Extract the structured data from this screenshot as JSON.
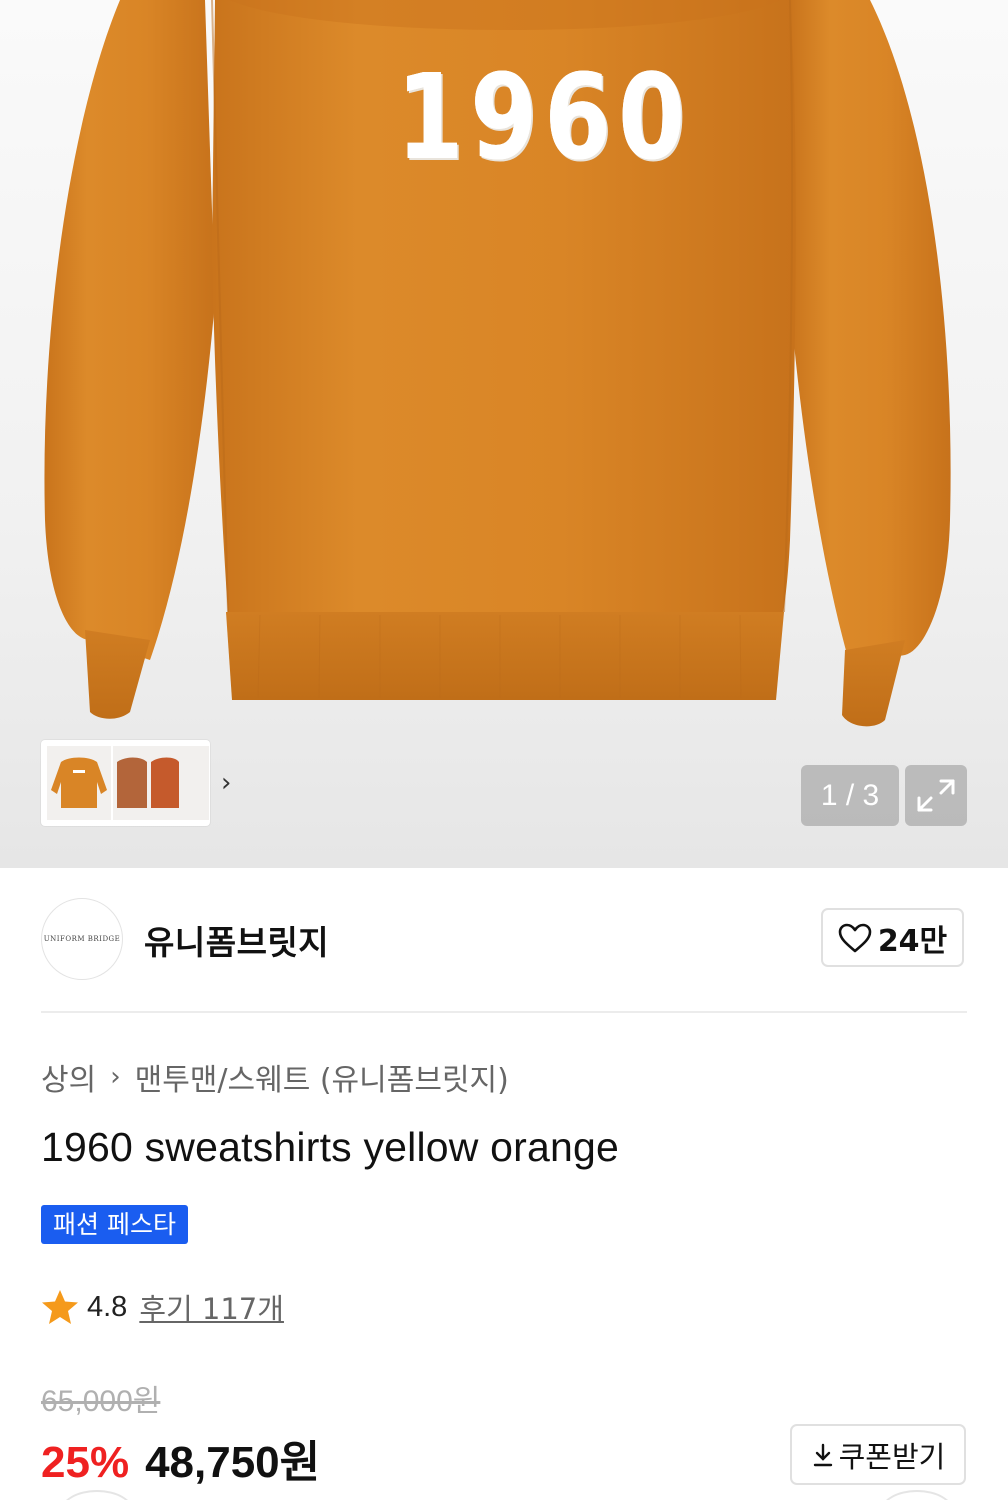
{
  "gallery": {
    "print_text": "1960",
    "counter": "1 / 3",
    "expand_icon": "expand-icon",
    "thumbnail_chevron": "›"
  },
  "shop": {
    "logo_text": "UNIFORM BRIDGE",
    "name": "유니폼브릿지",
    "like_count": "24만"
  },
  "breadcrumb": {
    "category": "상의",
    "separator": "›",
    "subcategory": "맨투맨/스웨트 (유니폼브릿지)"
  },
  "product": {
    "title": "1960 sweatshirts yellow orange",
    "badge": "패션 페스타",
    "rating": "4.8",
    "reviews": "후기 117개",
    "original_price": "65,000원",
    "discount": "25%",
    "sale_price": "48,750원",
    "coupon_label": "쿠폰받기"
  },
  "colors": {
    "sweatshirt": "#d98526",
    "badge": "#1a5df0",
    "discount": "#ef2121",
    "star": "#f59a1b"
  }
}
